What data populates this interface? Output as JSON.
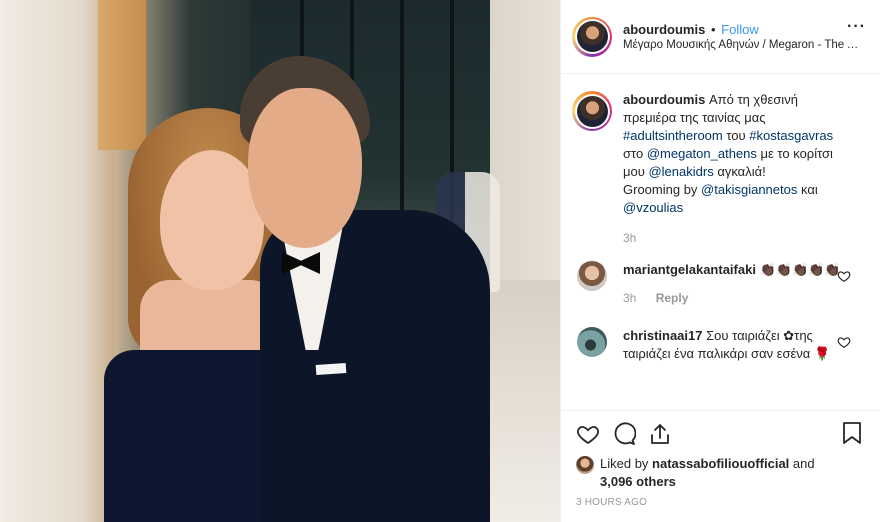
{
  "header": {
    "username": "abourdoumis",
    "separator": "•",
    "follow_label": "Follow",
    "location": "Μέγαρο Μουσικής Αθηνών / Megaron - The Athens Concert Hall",
    "more_icon": "more-horizontal-icon"
  },
  "caption": {
    "username": "abourdoumis",
    "text_1": "Από τη χθεσινή πρεμιέρα της ταινίας μας",
    "tag_1": "#adultsintheroom",
    "text_2": "του",
    "tag_2": "#kostasgavras",
    "text_3": "στο",
    "mention_1": "@megaton_athens",
    "text_4": "με το κορίτσι μου",
    "mention_2": "@lenakidrs",
    "text_5": "αγκαλιά!",
    "text_6": "Grooming by",
    "mention_3": "@takisgiannetos",
    "text_7": "και",
    "mention_4": "@vzoulias",
    "time": "3h"
  },
  "comments": [
    {
      "username": "mariantgelakantaifaki",
      "text": "👏🏿👏🏿👏🏿👏🏿👏🏿",
      "time": "3h",
      "reply_label": "Reply"
    },
    {
      "username": "christinaai17",
      "text": "Σου ταιριάζει ✿της ταιριάζει ένα παλικάρι σαν εσένα 🌹",
      "time": "",
      "reply_label": ""
    }
  ],
  "likes": {
    "prefix": "Liked by",
    "username": "natassabofiliouofficial",
    "conjunction": "and",
    "count_text": "3,096 others"
  },
  "timestamp": "3 HOURS AGO",
  "colors": {
    "link_blue": "#3897f0",
    "hashtag_navy": "#003569",
    "muted_gray": "#999999",
    "border": "#efefef"
  },
  "icons": [
    "heart-icon",
    "comment-icon",
    "share-icon",
    "bookmark-icon"
  ]
}
